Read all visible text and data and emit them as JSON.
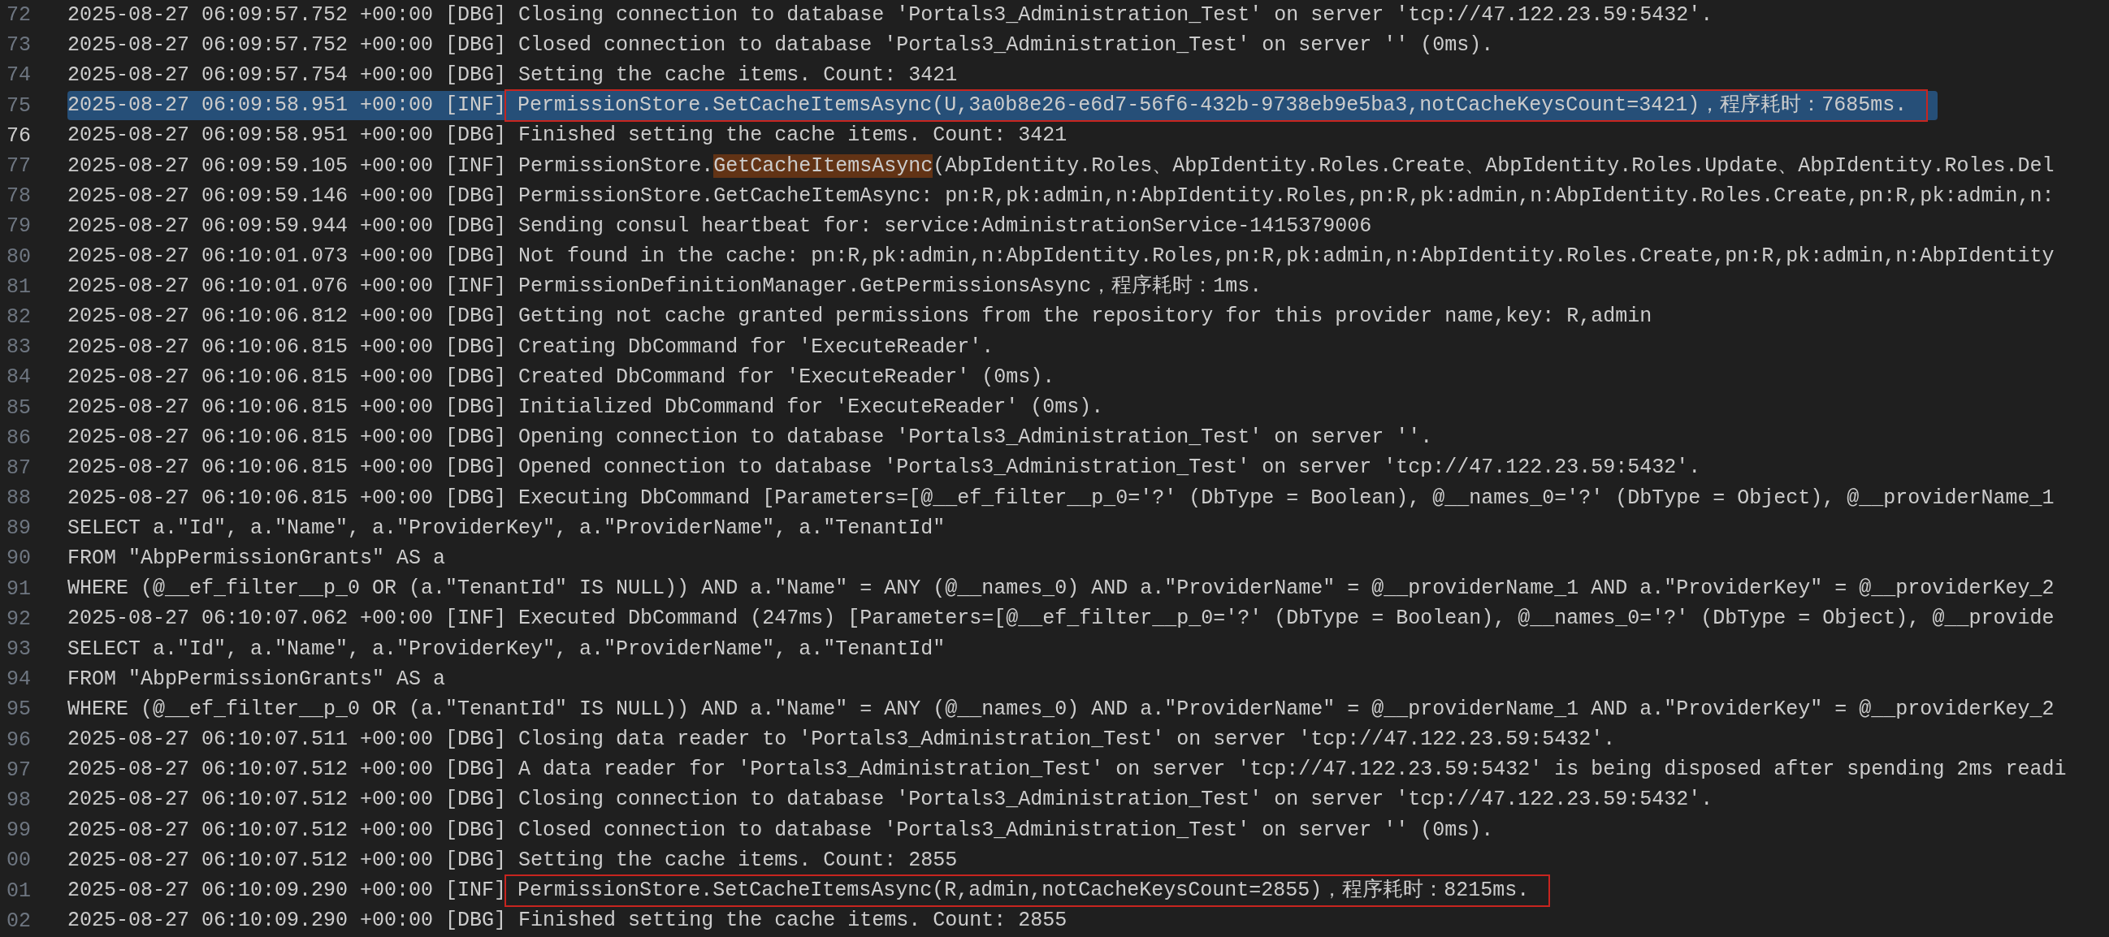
{
  "editor": {
    "lines": [
      {
        "number": "72",
        "kind": "log",
        "current": false,
        "selected": false,
        "annotated": false,
        "timestamp": "2025-08-27 06:09:57.752 +00:00",
        "level": "[DBG]",
        "segments": [
          {
            "text": "Closing connection to database 'Portals3_Administration_Test' on server 'tcp://47.122.23.59:5432'.",
            "match": false
          }
        ]
      },
      {
        "number": "73",
        "kind": "log",
        "current": false,
        "selected": false,
        "annotated": false,
        "timestamp": "2025-08-27 06:09:57.752 +00:00",
        "level": "[DBG]",
        "segments": [
          {
            "text": "Closed connection to database 'Portals3_Administration_Test' on server '' (0ms).",
            "match": false
          }
        ]
      },
      {
        "number": "74",
        "kind": "log",
        "current": false,
        "selected": false,
        "annotated": false,
        "timestamp": "2025-08-27 06:09:57.754 +00:00",
        "level": "[DBG]",
        "segments": [
          {
            "text": "Setting the cache items. Count: 3421",
            "match": false
          }
        ]
      },
      {
        "number": "75",
        "kind": "log",
        "current": false,
        "selected": true,
        "annotated": true,
        "timestamp": "2025-08-27 06:09:58.951 +00:00",
        "level": "[INF]",
        "segments": [
          {
            "text": "PermissionStore.SetCacheItemsAsync(U,3a0b8e26-e6d7-56f6-432b-9738eb9e5ba3,notCacheKeysCount=3421)，程序耗时：7685ms.",
            "match": false
          }
        ]
      },
      {
        "number": "76",
        "kind": "log",
        "current": true,
        "selected": false,
        "annotated": false,
        "timestamp": "2025-08-27 06:09:58.951 +00:00",
        "level": "[DBG]",
        "segments": [
          {
            "text": "Finished setting the cache items. Count: 3421",
            "match": false
          }
        ]
      },
      {
        "number": "77",
        "kind": "log",
        "current": false,
        "selected": false,
        "annotated": false,
        "timestamp": "2025-08-27 06:09:59.105 +00:00",
        "level": "[INF]",
        "segments": [
          {
            "text": "PermissionStore.",
            "match": false
          },
          {
            "text": "GetCacheItemsAsync",
            "match": true
          },
          {
            "text": "(AbpIdentity.Roles、AbpIdentity.Roles.Create、AbpIdentity.Roles.Update、AbpIdentity.Roles.Del",
            "match": false
          }
        ]
      },
      {
        "number": "78",
        "kind": "log",
        "current": false,
        "selected": false,
        "annotated": false,
        "timestamp": "2025-08-27 06:09:59.146 +00:00",
        "level": "[DBG]",
        "segments": [
          {
            "text": "PermissionStore.GetCacheItemAsync: pn:R,pk:admin,n:AbpIdentity.Roles,pn:R,pk:admin,n:AbpIdentity.Roles.Create,pn:R,pk:admin,n:",
            "match": false
          }
        ]
      },
      {
        "number": "79",
        "kind": "log",
        "current": false,
        "selected": false,
        "annotated": false,
        "timestamp": "2025-08-27 06:09:59.944 +00:00",
        "level": "[DBG]",
        "segments": [
          {
            "text": "Sending consul heartbeat for: service:AdministrationService-1415379006",
            "match": false
          }
        ]
      },
      {
        "number": "80",
        "kind": "log",
        "current": false,
        "selected": false,
        "annotated": false,
        "timestamp": "2025-08-27 06:10:01.073 +00:00",
        "level": "[DBG]",
        "segments": [
          {
            "text": "Not found in the cache: pn:R,pk:admin,n:AbpIdentity.Roles,pn:R,pk:admin,n:AbpIdentity.Roles.Create,pn:R,pk:admin,n:AbpIdentity",
            "match": false
          }
        ]
      },
      {
        "number": "81",
        "kind": "log",
        "current": false,
        "selected": false,
        "annotated": false,
        "timestamp": "2025-08-27 06:10:01.076 +00:00",
        "level": "[INF]",
        "segments": [
          {
            "text": "PermissionDefinitionManager.GetPermissionsAsync，程序耗时：1ms.",
            "match": false
          }
        ]
      },
      {
        "number": "82",
        "kind": "log",
        "current": false,
        "selected": false,
        "annotated": false,
        "timestamp": "2025-08-27 06:10:06.812 +00:00",
        "level": "[DBG]",
        "segments": [
          {
            "text": "Getting not cache granted permissions from the repository for this provider name,key: R,admin",
            "match": false
          }
        ]
      },
      {
        "number": "83",
        "kind": "log",
        "current": false,
        "selected": false,
        "annotated": false,
        "timestamp": "2025-08-27 06:10:06.815 +00:00",
        "level": "[DBG]",
        "segments": [
          {
            "text": "Creating DbCommand for 'ExecuteReader'.",
            "match": false
          }
        ]
      },
      {
        "number": "84",
        "kind": "log",
        "current": false,
        "selected": false,
        "annotated": false,
        "timestamp": "2025-08-27 06:10:06.815 +00:00",
        "level": "[DBG]",
        "segments": [
          {
            "text": "Created DbCommand for 'ExecuteReader' (0ms).",
            "match": false
          }
        ]
      },
      {
        "number": "85",
        "kind": "log",
        "current": false,
        "selected": false,
        "annotated": false,
        "timestamp": "2025-08-27 06:10:06.815 +00:00",
        "level": "[DBG]",
        "segments": [
          {
            "text": "Initialized DbCommand for 'ExecuteReader' (0ms).",
            "match": false
          }
        ]
      },
      {
        "number": "86",
        "kind": "log",
        "current": false,
        "selected": false,
        "annotated": false,
        "timestamp": "2025-08-27 06:10:06.815 +00:00",
        "level": "[DBG]",
        "segments": [
          {
            "text": "Opening connection to database 'Portals3_Administration_Test' on server ''.",
            "match": false
          }
        ]
      },
      {
        "number": "87",
        "kind": "log",
        "current": false,
        "selected": false,
        "annotated": false,
        "timestamp": "2025-08-27 06:10:06.815 +00:00",
        "level": "[DBG]",
        "segments": [
          {
            "text": "Opened connection to database 'Portals3_Administration_Test' on server 'tcp://47.122.23.59:5432'.",
            "match": false
          }
        ]
      },
      {
        "number": "88",
        "kind": "log",
        "current": false,
        "selected": false,
        "annotated": false,
        "timestamp": "2025-08-27 06:10:06.815 +00:00",
        "level": "[DBG]",
        "segments": [
          {
            "text": "Executing DbCommand [Parameters=[@__ef_filter__p_0='?' (DbType = Boolean), @__names_0='?' (DbType = Object), @__providerName_1",
            "match": false
          }
        ]
      },
      {
        "number": "89",
        "kind": "sql",
        "current": false,
        "selected": false,
        "segments": [
          {
            "text": "SELECT a.\"Id\", a.\"Name\", a.\"ProviderKey\", a.\"ProviderName\", a.\"TenantId\"",
            "match": false
          }
        ]
      },
      {
        "number": "90",
        "kind": "sql",
        "current": false,
        "selected": false,
        "segments": [
          {
            "text": "FROM \"AbpPermissionGrants\" AS a",
            "match": false
          }
        ]
      },
      {
        "number": "91",
        "kind": "sql",
        "current": false,
        "selected": false,
        "segments": [
          {
            "text": "WHERE (@__ef_filter__p_0 OR (a.\"TenantId\" IS NULL)) AND a.\"Name\" = ANY (@__names_0) AND a.\"ProviderName\" = @__providerName_1 AND a.\"ProviderKey\" = @__providerKey_2",
            "match": false
          }
        ]
      },
      {
        "number": "92",
        "kind": "log",
        "current": false,
        "selected": false,
        "annotated": false,
        "timestamp": "2025-08-27 06:10:07.062 +00:00",
        "level": "[INF]",
        "segments": [
          {
            "text": "Executed DbCommand (247ms) [Parameters=[@__ef_filter__p_0='?' (DbType = Boolean), @__names_0='?' (DbType = Object), @__provide",
            "match": false
          }
        ]
      },
      {
        "number": "93",
        "kind": "sql",
        "current": false,
        "selected": false,
        "segments": [
          {
            "text": "SELECT a.\"Id\", a.\"Name\", a.\"ProviderKey\", a.\"ProviderName\", a.\"TenantId\"",
            "match": false
          }
        ]
      },
      {
        "number": "94",
        "kind": "sql",
        "current": false,
        "selected": false,
        "segments": [
          {
            "text": "FROM \"AbpPermissionGrants\" AS a",
            "match": false
          }
        ]
      },
      {
        "number": "95",
        "kind": "sql",
        "current": false,
        "selected": false,
        "segments": [
          {
            "text": "WHERE (@__ef_filter__p_0 OR (a.\"TenantId\" IS NULL)) AND a.\"Name\" = ANY (@__names_0) AND a.\"ProviderName\" = @__providerName_1 AND a.\"ProviderKey\" = @__providerKey_2",
            "match": false
          }
        ]
      },
      {
        "number": "96",
        "kind": "log",
        "current": false,
        "selected": false,
        "annotated": false,
        "timestamp": "2025-08-27 06:10:07.511 +00:00",
        "level": "[DBG]",
        "segments": [
          {
            "text": "Closing data reader to 'Portals3_Administration_Test' on server 'tcp://47.122.23.59:5432'.",
            "match": false
          }
        ]
      },
      {
        "number": "97",
        "kind": "log",
        "current": false,
        "selected": false,
        "annotated": false,
        "timestamp": "2025-08-27 06:10:07.512 +00:00",
        "level": "[DBG]",
        "segments": [
          {
            "text": "A data reader for 'Portals3_Administration_Test' on server 'tcp://47.122.23.59:5432' is being disposed after spending 2ms readi",
            "match": false
          }
        ]
      },
      {
        "number": "98",
        "kind": "log",
        "current": false,
        "selected": false,
        "annotated": false,
        "timestamp": "2025-08-27 06:10:07.512 +00:00",
        "level": "[DBG]",
        "segments": [
          {
            "text": "Closing connection to database 'Portals3_Administration_Test' on server 'tcp://47.122.23.59:5432'.",
            "match": false
          }
        ]
      },
      {
        "number": "99",
        "kind": "log",
        "current": false,
        "selected": false,
        "annotated": false,
        "timestamp": "2025-08-27 06:10:07.512 +00:00",
        "level": "[DBG]",
        "segments": [
          {
            "text": "Closed connection to database 'Portals3_Administration_Test' on server '' (0ms).",
            "match": false
          }
        ]
      },
      {
        "number": "00",
        "kind": "log",
        "current": false,
        "selected": false,
        "annotated": false,
        "timestamp": "2025-08-27 06:10:07.512 +00:00",
        "level": "[DBG]",
        "segments": [
          {
            "text": "Setting the cache items. Count: 2855",
            "match": false
          }
        ]
      },
      {
        "number": "01",
        "kind": "log",
        "current": false,
        "selected": false,
        "annotated": true,
        "timestamp": "2025-08-27 06:10:09.290 +00:00",
        "level": "[INF]",
        "segments": [
          {
            "text": "PermissionStore.SetCacheItemsAsync(R,admin,notCacheKeysCount=2855)，程序耗时：8215ms.",
            "match": false
          }
        ]
      },
      {
        "number": "02",
        "kind": "log",
        "current": false,
        "selected": false,
        "annotated": false,
        "timestamp": "2025-08-27 06:10:09.290 +00:00",
        "level": "[DBG]",
        "segments": [
          {
            "text": "Finished setting the cache items. Count: 2855",
            "match": false
          }
        ]
      }
    ]
  }
}
